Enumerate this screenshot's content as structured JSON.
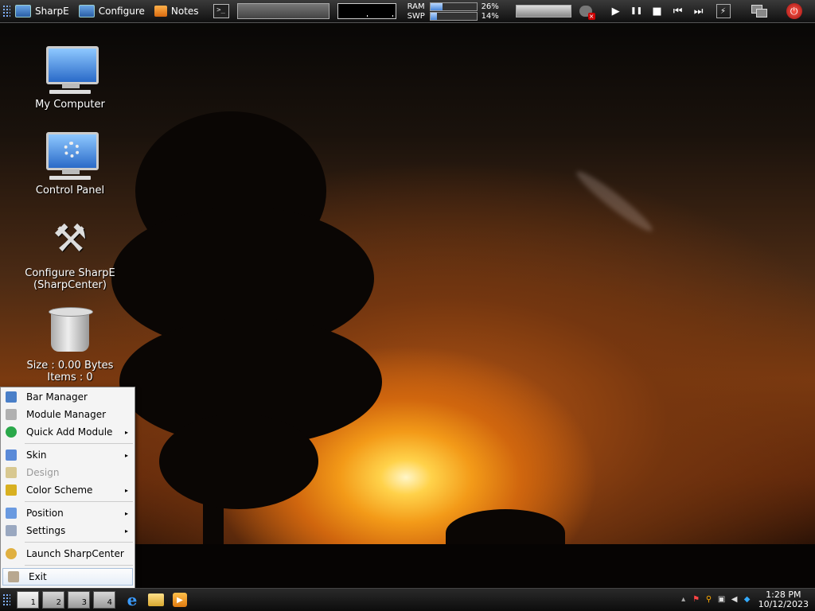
{
  "topbar": {
    "items": [
      {
        "label": "SharpE",
        "icon": "monitor-icon"
      },
      {
        "label": "Configure",
        "icon": "monitor-icon"
      },
      {
        "label": "Notes",
        "icon": "notes-icon"
      }
    ],
    "terminal_glyph": ">_",
    "memory": {
      "ram_label": "RAM",
      "ram_value": "26%",
      "ram_fraction": 0.26,
      "swp_label": "SWP",
      "swp_value": "14%",
      "swp_fraction": 0.14
    },
    "media_controls": {
      "play": "▶",
      "pause": "❚❚",
      "stop": "■",
      "previous": "⏮",
      "next": "⏭"
    },
    "power_glyph": "⏻"
  },
  "desktop": {
    "icons": [
      {
        "label": "My Computer",
        "icon": "computer-icon"
      },
      {
        "label": "Control Panel",
        "icon": "control-panel-icon"
      },
      {
        "label": "Configure SharpE",
        "label2": "(SharpCenter)",
        "icon": "tools-icon"
      },
      {
        "label": "Size : 0.00 Bytes",
        "label2": "Items : 0",
        "icon": "recycle-bin-icon"
      }
    ]
  },
  "menu": {
    "items": [
      {
        "label": "Bar Manager",
        "icon": "bar-manager-icon",
        "color": "#4a7fc8"
      },
      {
        "label": "Module Manager",
        "icon": "module-icon",
        "color": "#b0b0b0"
      },
      {
        "label": "Quick Add Module",
        "icon": "add-icon",
        "color": "#2aa84a",
        "submenu": "▸"
      },
      {
        "label": "Skin",
        "icon": "skin-icon",
        "color": "#5a8ad8",
        "submenu": "▸"
      },
      {
        "label": "Design",
        "icon": "design-icon",
        "color": "#d8c890",
        "disabled": true
      },
      {
        "label": "Color Scheme",
        "icon": "brush-icon",
        "color": "#d8b020",
        "submenu": "▸"
      },
      {
        "label": "Position",
        "icon": "position-icon",
        "color": "#6a9ae0",
        "submenu": "▸"
      },
      {
        "label": "Settings",
        "icon": "wrench-icon",
        "color": "#9aa8c0",
        "submenu": "▸"
      },
      {
        "label": "Launch SharpCenter",
        "icon": "gear-icon",
        "color": "#e0b040"
      },
      {
        "label": "Exit",
        "icon": "exit-icon",
        "color": "#b8a890"
      }
    ]
  },
  "taskbar": {
    "workspaces": [
      "1",
      "2",
      "3",
      "4"
    ],
    "clock_time": "1:28 PM",
    "clock_date": "10/12/2023"
  }
}
